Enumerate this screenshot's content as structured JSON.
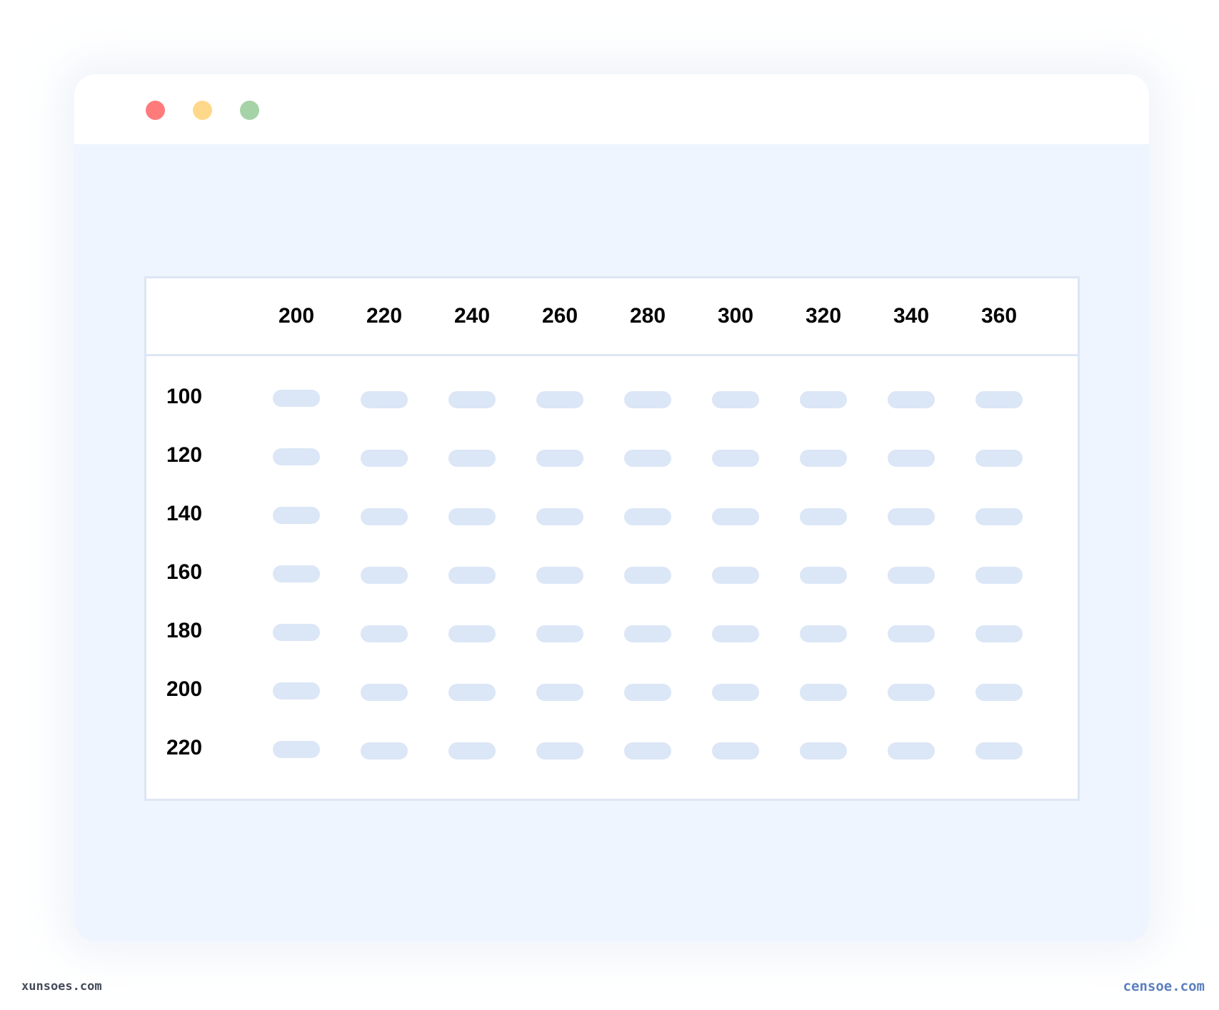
{
  "window": {
    "controls": [
      {
        "name": "close",
        "color": "#ff7b7b"
      },
      {
        "name": "minimize",
        "color": "#ffd88a"
      },
      {
        "name": "maximize",
        "color": "#a6d2a8"
      }
    ]
  },
  "table": {
    "columns": [
      "200",
      "220",
      "240",
      "260",
      "280",
      "300",
      "320",
      "340",
      "360"
    ],
    "rows": [
      "100",
      "120",
      "140",
      "160",
      "180",
      "200",
      "220"
    ],
    "cell_placeholder_color": "#dbe6f6"
  },
  "footer": {
    "watermark_left": "xunsoes.com",
    "watermark_right": "censoe.com"
  }
}
